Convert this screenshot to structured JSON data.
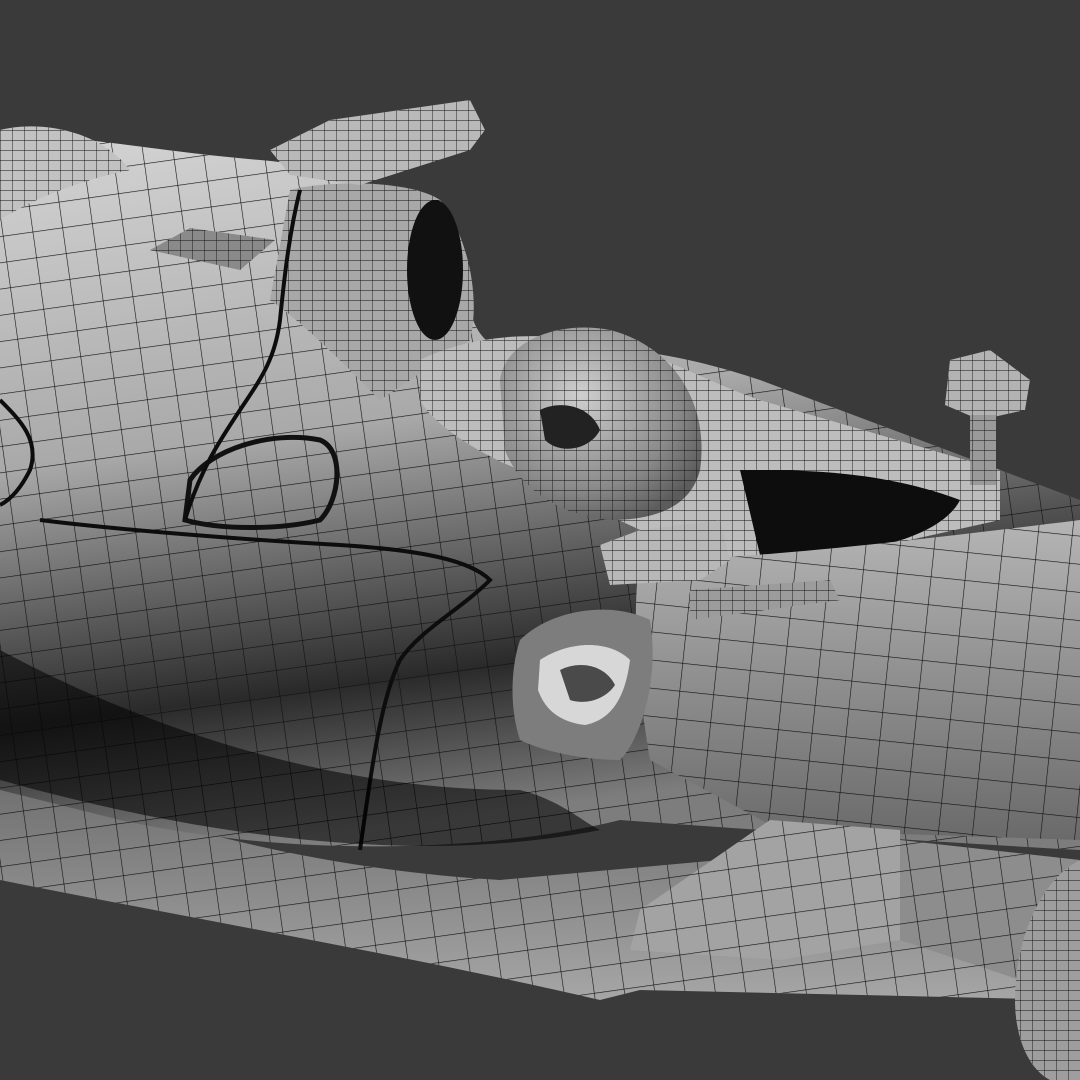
{
  "viewport": {
    "background_color": "#3a3a3a",
    "shading": "smooth-shaded-with-wireframe",
    "mesh_colors": {
      "light": "#c9c9c9",
      "mid": "#9a9a9a",
      "dark": "#555555",
      "edge": "#0a0a0a"
    }
  }
}
